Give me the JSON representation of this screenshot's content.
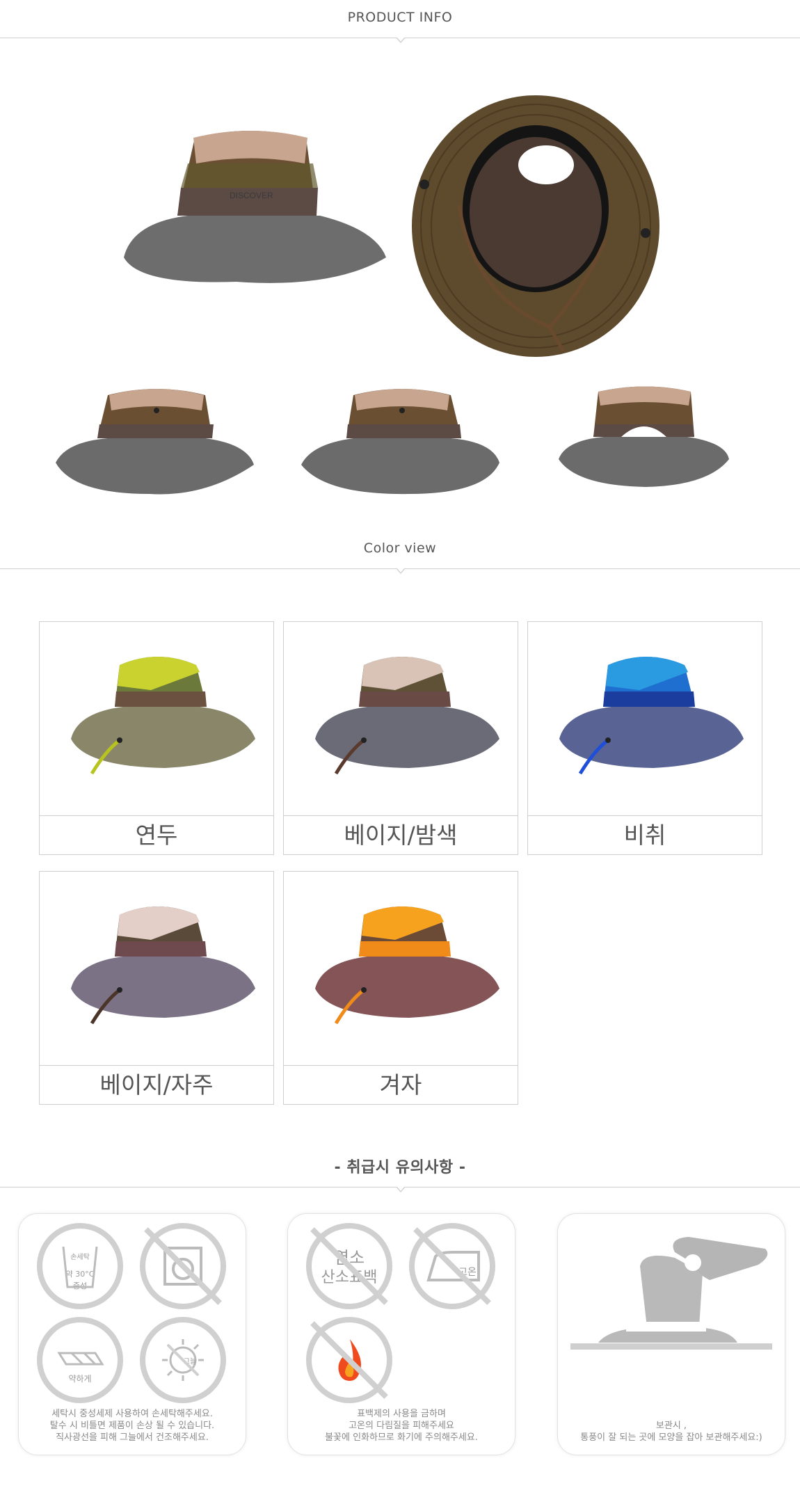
{
  "sections": {
    "product_info": "PRODUCT INFO",
    "color_view": "Color view",
    "care": "-  취급시 유의사항 -"
  },
  "colors": {
    "items": [
      {
        "label": "연두",
        "crown": "#c9d22e",
        "panel": "#6b7a3a",
        "band": "#6b5240",
        "brim": "#8a866a",
        "strap": "#b7c41f"
      },
      {
        "label": "베이지/밤색",
        "crown": "#d9c3b6",
        "panel": "#5e5136",
        "band": "#6a4a44",
        "brim": "#6b6b78",
        "strap": "#5b3a2e"
      },
      {
        "label": "비취",
        "crown": "#2a9be0",
        "panel": "#1f6fd0",
        "band": "#1b3e9e",
        "brim": "#5a6494",
        "strap": "#1f4ed8"
      },
      {
        "label": "베이지/자주",
        "crown": "#e3cfc8",
        "panel": "#5a4a3a",
        "band": "#6e4a4e",
        "brim": "#7c7286",
        "strap": "#4a3528"
      },
      {
        "label": "겨자",
        "crown": "#f6a21f",
        "panel": "#6b4a36",
        "band": "#f08a18",
        "brim": "#845456",
        "strap": "#f08a18"
      }
    ]
  },
  "care": {
    "panel1": {
      "icon1": {
        "top": "손세탁",
        "mid": "약 30°C",
        "bot": "중성"
      },
      "icon3": "약하게",
      "icon4": "그늘",
      "text": "세탁시 중성세제 사용하여 손세탁해주세요.\n탈수 시 비틀면 제품이 손상 될 수 있습니다.\n직사광선을 피해 그늘에서 건조해주세요."
    },
    "panel2": {
      "icon1": {
        "line1": "염소",
        "line2": "산소표백"
      },
      "icon2": "고온",
      "text": "표백제의 사용을 금하며\n고온의 다림질을 피해주세요\n불꽃에 인화하므로 화기에 주의해주세요."
    },
    "panel3": {
      "text": "보관시 ,\n통풍이 잘 되는 곳에 모양을 잡아 보관해주세요:)"
    }
  }
}
